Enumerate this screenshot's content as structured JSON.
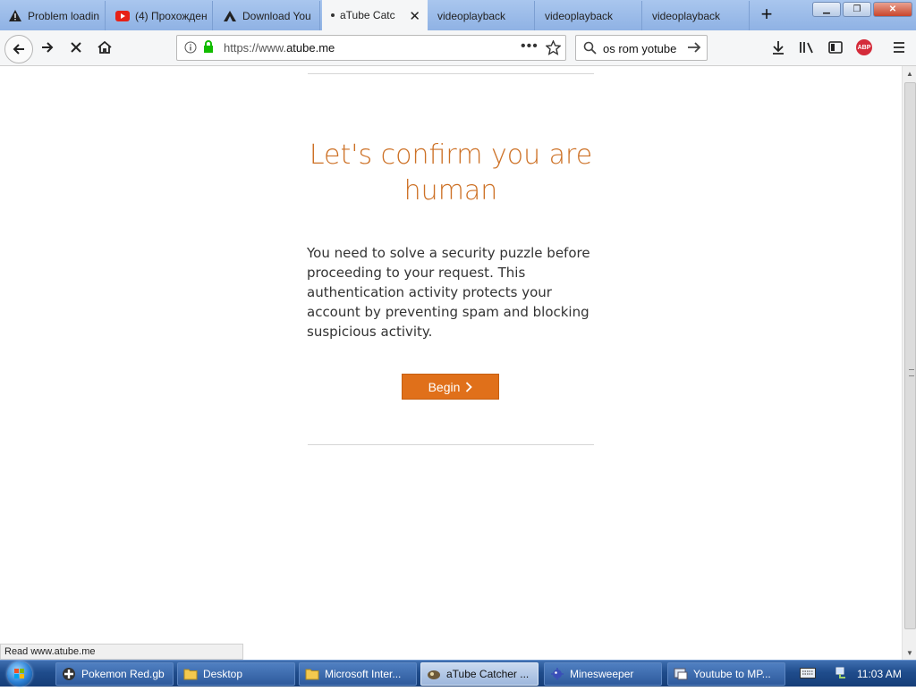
{
  "tabs": [
    {
      "label": "Problem loadin",
      "icon": "warning-icon"
    },
    {
      "label": "(4) Прохожден",
      "icon": "youtube-icon"
    },
    {
      "label": "Download You",
      "icon": "triangle-logo-icon"
    },
    {
      "label": "aTube Catche",
      "icon": "loading-dot-icon",
      "active": true
    },
    {
      "label": "videoplayback"
    },
    {
      "label": "videoplayback"
    },
    {
      "label": "videoplayback"
    }
  ],
  "address": {
    "prefix": "https://www.",
    "host": "atube.me"
  },
  "search": {
    "value": "os rom yotube"
  },
  "page": {
    "title": "Let's confirm you are human",
    "body": "You need to solve a security puzzle before proceeding to your request. This authentication activity protects your account by preventing spam and blocking suspicious activity.",
    "button_label": "Begin"
  },
  "status": "Read www.atube.me",
  "taskbar": {
    "items": [
      {
        "label": "Pokemon Red.gb",
        "icon": "gameboy-icon"
      },
      {
        "label": "Desktop",
        "icon": "folder-icon"
      },
      {
        "label": "Microsoft Inter...",
        "icon": "folder-icon"
      },
      {
        "label": "aTube Catcher ...",
        "icon": "atube-icon",
        "active": true
      },
      {
        "label": "Minesweeper",
        "icon": "minesweeper-icon"
      },
      {
        "label": "Youtube to MP...",
        "icon": "converter-icon"
      }
    ],
    "time": "11:03 AM"
  },
  "colors": {
    "accent": "#e0701a",
    "title": "#cd7126"
  }
}
